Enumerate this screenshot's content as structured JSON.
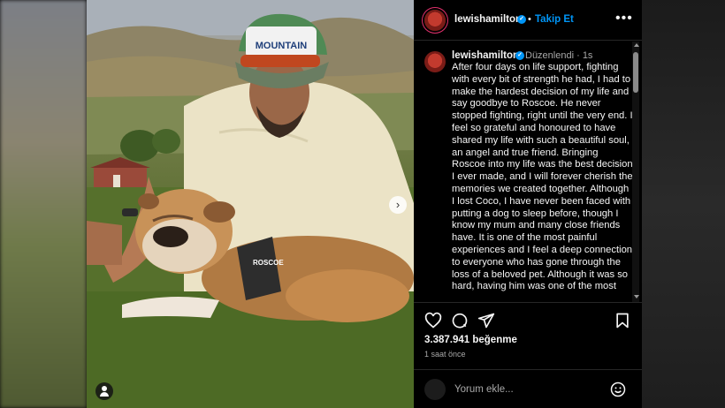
{
  "post": {
    "username": "lewishamilton",
    "follow_label": "Takip Et",
    "more_label": "•••",
    "caption_username": "lewishamilton",
    "caption_meta": "Düzenlendi · 1s",
    "caption_text": "After four days on life support, fighting with every bit of strength he had, I had to make the hardest decision of my life and say goodbye to Roscoe. He never stopped fighting, right until the very end. I feel so grateful and honoured to have shared my life with such a beautiful soul, an angel and true friend. Bringing Roscoe into my life was the best decision I ever made, and I will forever cherish the memories we created together. Although I lost Coco, I have never been faced with putting a dog to sleep before, though I know my mum and many close friends have. It is one of the most painful experiences and I feel a deep connection to everyone who has gone through the loss of a beloved pet. Although it was so hard, having him was one of the most",
    "likes": "3.387.941 beğenme",
    "time_ago": "1 saat önce",
    "comment_placeholder": "Yorum ekle...",
    "image_text": {
      "cap_text": "MOUNTAIN",
      "harness_text": "ROSCOE"
    }
  },
  "icons": [
    "heart-icon",
    "comment-icon",
    "share-icon",
    "bookmark-icon",
    "emoji-icon",
    "next-arrow-icon",
    "user-tag-icon",
    "verified-icon"
  ],
  "colors": {
    "accent": "#0095f6",
    "panel_bg": "#000000",
    "muted_text": "#a8a8a8"
  }
}
